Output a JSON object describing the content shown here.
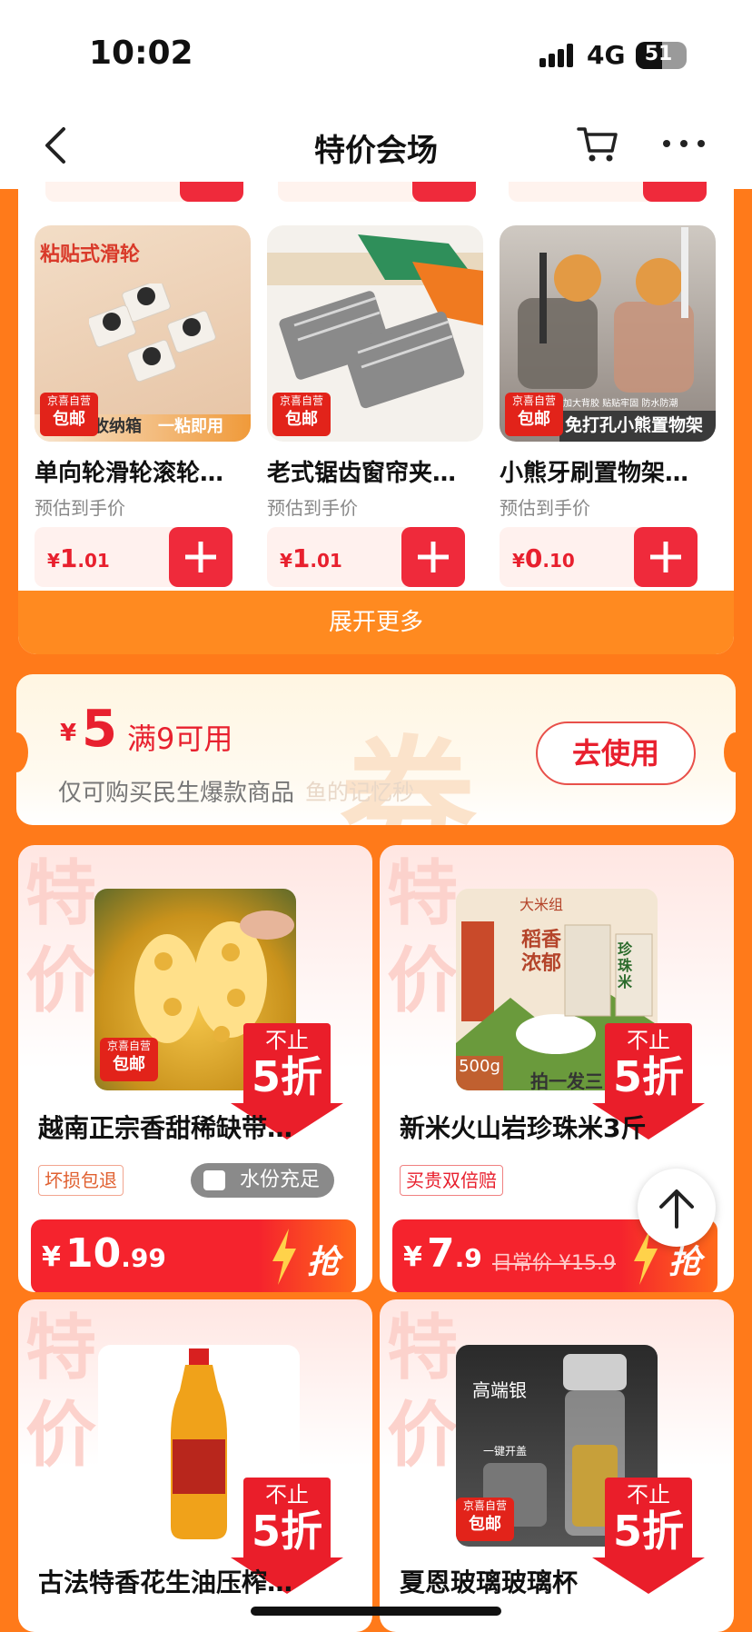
{
  "status_bar": {
    "time": "10:02",
    "network": "4G",
    "battery": "51",
    "battery_level": 0.51
  },
  "nav": {
    "title": "特价会场",
    "icons": [
      "back-icon",
      "cart-icon",
      "more-icon"
    ]
  },
  "products": [
    {
      "name": "单向轮滑轮滚轮…",
      "est_label": "预估到手价",
      "price_int": "1",
      "price_dec": ".01",
      "currency": "¥",
      "tag_top": "京喜自营",
      "tag_bottom": "包邮",
      "img_caption": "粘贴式滑轮",
      "img_bottom_left": "收纳箱",
      "img_bottom_right": "一粘即用"
    },
    {
      "name": "老式锯齿窗帘夹…",
      "est_label": "预估到手价",
      "price_int": "1",
      "price_dec": ".01",
      "currency": "¥",
      "tag_top": "京喜自营",
      "tag_bottom": "包邮"
    },
    {
      "name": "小熊牙刷置物架…",
      "est_label": "预估到手价",
      "price_int": "0",
      "price_dec": ".10",
      "currency": "¥",
      "tag_top": "京喜自营",
      "tag_bottom": "包邮",
      "img_caption": "免打孔小熊置物架",
      "img_small": "加大背胶 贴贴牢固 防水防潮"
    }
  ],
  "expand_label": "展开更多",
  "coupon": {
    "currency": "¥",
    "amount": "5",
    "condition": "满9可用",
    "scope": "仅可购买民生爆款商品",
    "watermark": "鱼的记忆秒",
    "bg_char": "券",
    "button": "去使用"
  },
  "deals": [
    {
      "bg_char_1": "特",
      "bg_char_2": "价",
      "title": "越南正宗香甜稀缺带…",
      "tag": "坏损包退",
      "pill": "水份充足",
      "currency": "¥",
      "price_int": "10",
      "price_dec": ".99",
      "orig": "",
      "badge_l1": "不止",
      "badge_l2": "5折",
      "cta": "抢",
      "tag_top": "京喜自营",
      "tag_bottom": "包邮"
    },
    {
      "bg_char_1": "特",
      "bg_char_2": "价",
      "title": "新米火山岩珍珠米3斤",
      "tag": "买贵双倍赔",
      "currency": "¥",
      "price_int": "7",
      "price_dec": ".9",
      "orig": "日常价 ¥15.9",
      "badge_l1": "不止",
      "badge_l2": "5折",
      "cta": "抢",
      "img_text_1": "稻香",
      "img_text_2": "浓郁",
      "img_text_3": "珍珠米",
      "img_text_4": "大米组",
      "img_text_5": "500g",
      "img_text_6": "拍一发三"
    },
    {
      "bg_char_1": "特",
      "bg_char_2": "价",
      "title": "古法特香花生油压榨…",
      "badge_l1": "不止",
      "badge_l2": "5折"
    },
    {
      "bg_char_1": "特",
      "bg_char_2": "价",
      "title": "夏恩玻璃玻璃杯",
      "badge_l1": "不止",
      "badge_l2": "5折",
      "img_text": "高端银",
      "img_small": "一键开盖",
      "tag_top": "京喜自营",
      "tag_bottom": "包邮"
    }
  ]
}
